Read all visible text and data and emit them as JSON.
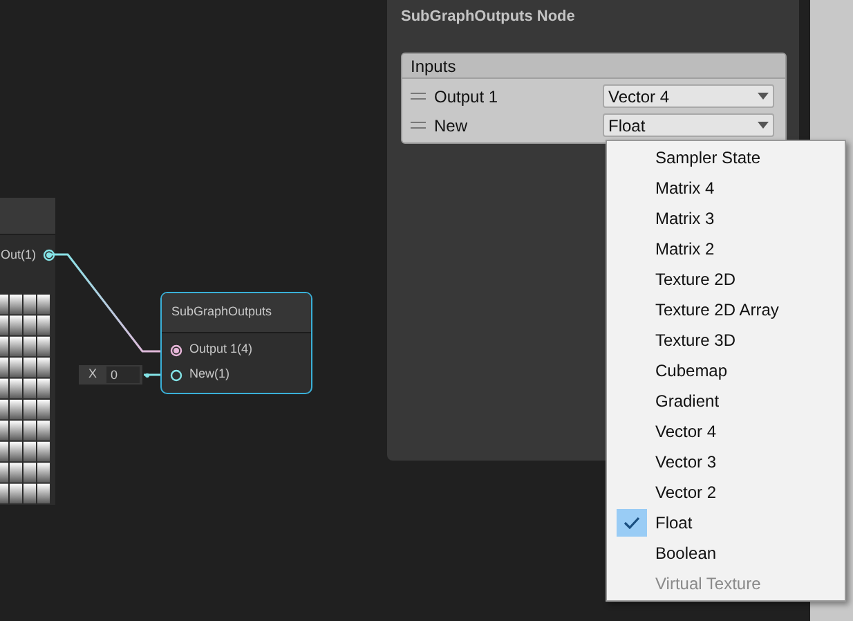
{
  "canvas": {
    "left_node": {
      "output_port": {
        "label": "Out(1)",
        "color": "#84e4e7"
      }
    },
    "subgraph_node": {
      "title": "SubGraphOutputs",
      "inputs": [
        {
          "label": "Output 1(4)",
          "color": "#e7b6d9",
          "kind": "filled"
        },
        {
          "label": "New(1)",
          "color": "#84e4e7",
          "kind": "hollow"
        }
      ]
    },
    "inline_value": {
      "axis": "X",
      "value": "0"
    }
  },
  "inspector": {
    "title": "SubGraphOutputs Node",
    "section": "Inputs",
    "inputs": [
      {
        "name": "Output 1",
        "type": "Vector 4"
      },
      {
        "name": "New",
        "type": "Float"
      }
    ]
  },
  "dropdown": {
    "items": [
      {
        "label": "Sampler State",
        "selected": false,
        "disabled": false
      },
      {
        "label": "Matrix 4",
        "selected": false,
        "disabled": false
      },
      {
        "label": "Matrix 3",
        "selected": false,
        "disabled": false
      },
      {
        "label": "Matrix 2",
        "selected": false,
        "disabled": false
      },
      {
        "label": "Texture 2D",
        "selected": false,
        "disabled": false
      },
      {
        "label": "Texture 2D Array",
        "selected": false,
        "disabled": false
      },
      {
        "label": "Texture 3D",
        "selected": false,
        "disabled": false
      },
      {
        "label": "Cubemap",
        "selected": false,
        "disabled": false
      },
      {
        "label": "Gradient",
        "selected": false,
        "disabled": false
      },
      {
        "label": "Vector 4",
        "selected": false,
        "disabled": false
      },
      {
        "label": "Vector 3",
        "selected": false,
        "disabled": false
      },
      {
        "label": "Vector 2",
        "selected": false,
        "disabled": false
      },
      {
        "label": "Float",
        "selected": true,
        "disabled": false
      },
      {
        "label": "Boolean",
        "selected": false,
        "disabled": false
      },
      {
        "label": "Virtual Texture",
        "selected": false,
        "disabled": true
      }
    ]
  }
}
